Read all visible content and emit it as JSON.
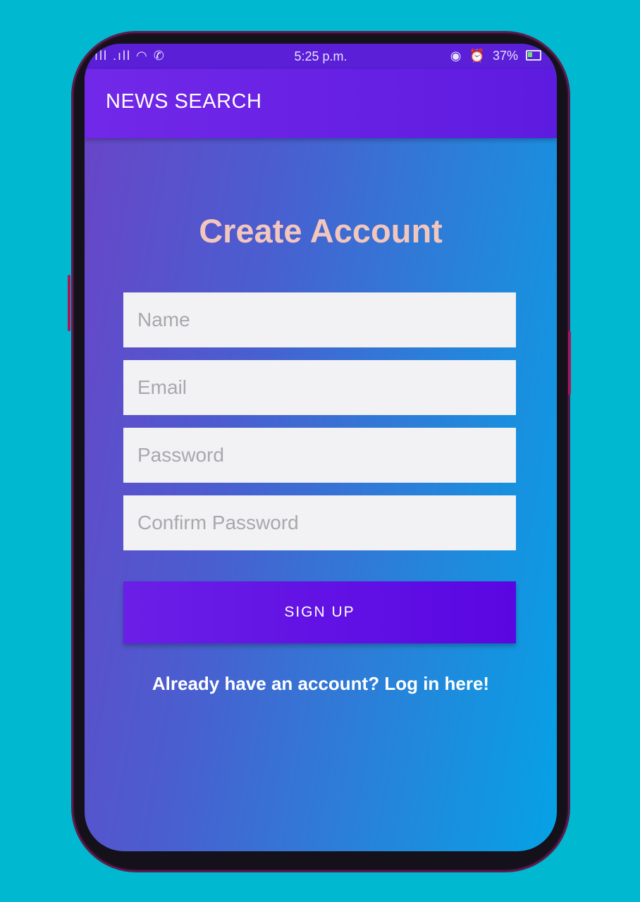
{
  "status_bar": {
    "signal": "ıll .ıll",
    "wifi_icon": "wifi-icon",
    "call_icon": "wifi-call-icon",
    "time": "5:25 p.m.",
    "eye_icon": "eye-icon",
    "alarm_icon": "alarm-icon",
    "battery": "37%"
  },
  "app_bar": {
    "title": "NEWS SEARCH"
  },
  "form": {
    "heading": "Create Account",
    "name_placeholder": "Name",
    "email_placeholder": "Email",
    "password_placeholder": "Password",
    "confirm_placeholder": "Confirm Password",
    "signup_label": "SIGN UP",
    "login_link": "Already have an account? Log in here!"
  },
  "colors": {
    "background": "#00b8cf",
    "app_bar": "#6a22e4",
    "heading": "#f2c6bd",
    "button": "#5e0fe4"
  }
}
